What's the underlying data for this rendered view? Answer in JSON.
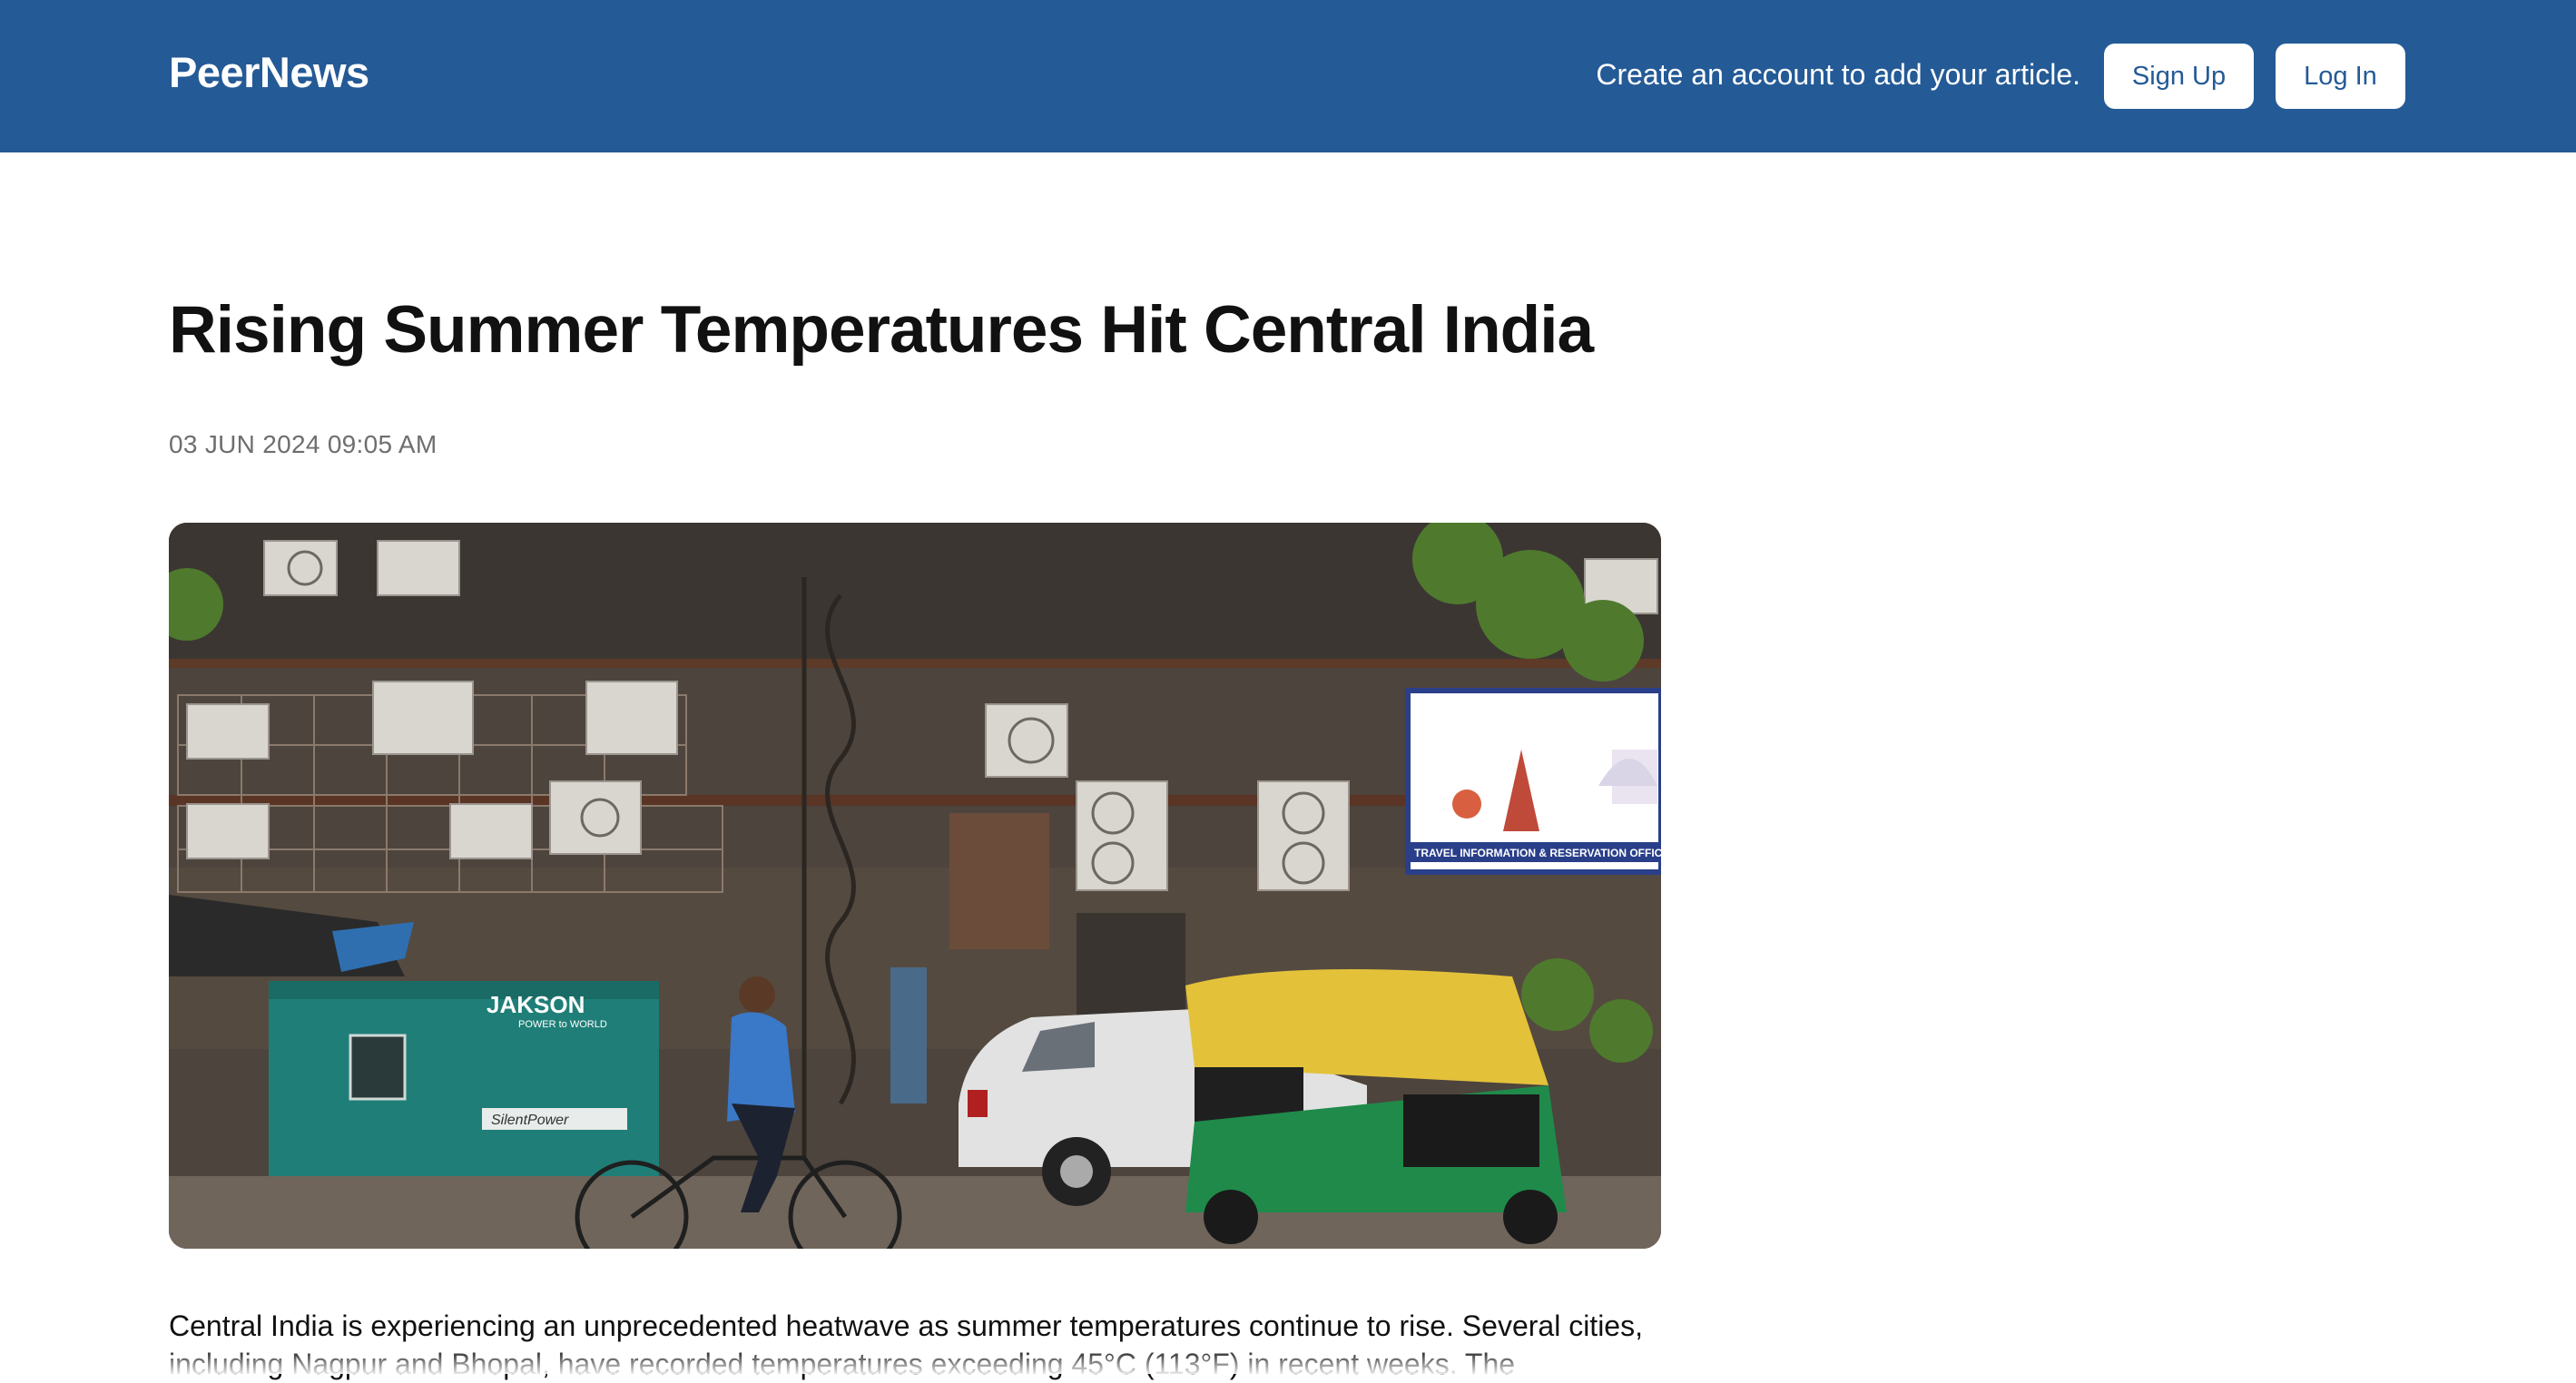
{
  "header": {
    "brand": "PeerNews",
    "promo_text": "Create an account to add your article.",
    "signup_label": "Sign Up",
    "login_label": "Log In"
  },
  "article": {
    "title": "Rising Summer Temperatures Hit Central India",
    "date": "03 JUN 2024 09:05 AM",
    "body": "Central India is experiencing an unprecedented heatwave as summer temperatures continue to rise. Several cities, including Nagpur and Bhopal, have recorded temperatures exceeding 45°C (113°F) in recent weeks. The"
  },
  "image": {
    "generator_brand": "JAKSON",
    "generator_tagline": "POWER to WORLD",
    "generator_model": "SilentPower",
    "billboard_caption": "TRAVEL INFORMATION & RESERVATION OFFICE, CONN"
  },
  "colors": {
    "header_bg": "#245a96",
    "button_text": "#245a96",
    "date_text": "#6e6e6e"
  }
}
